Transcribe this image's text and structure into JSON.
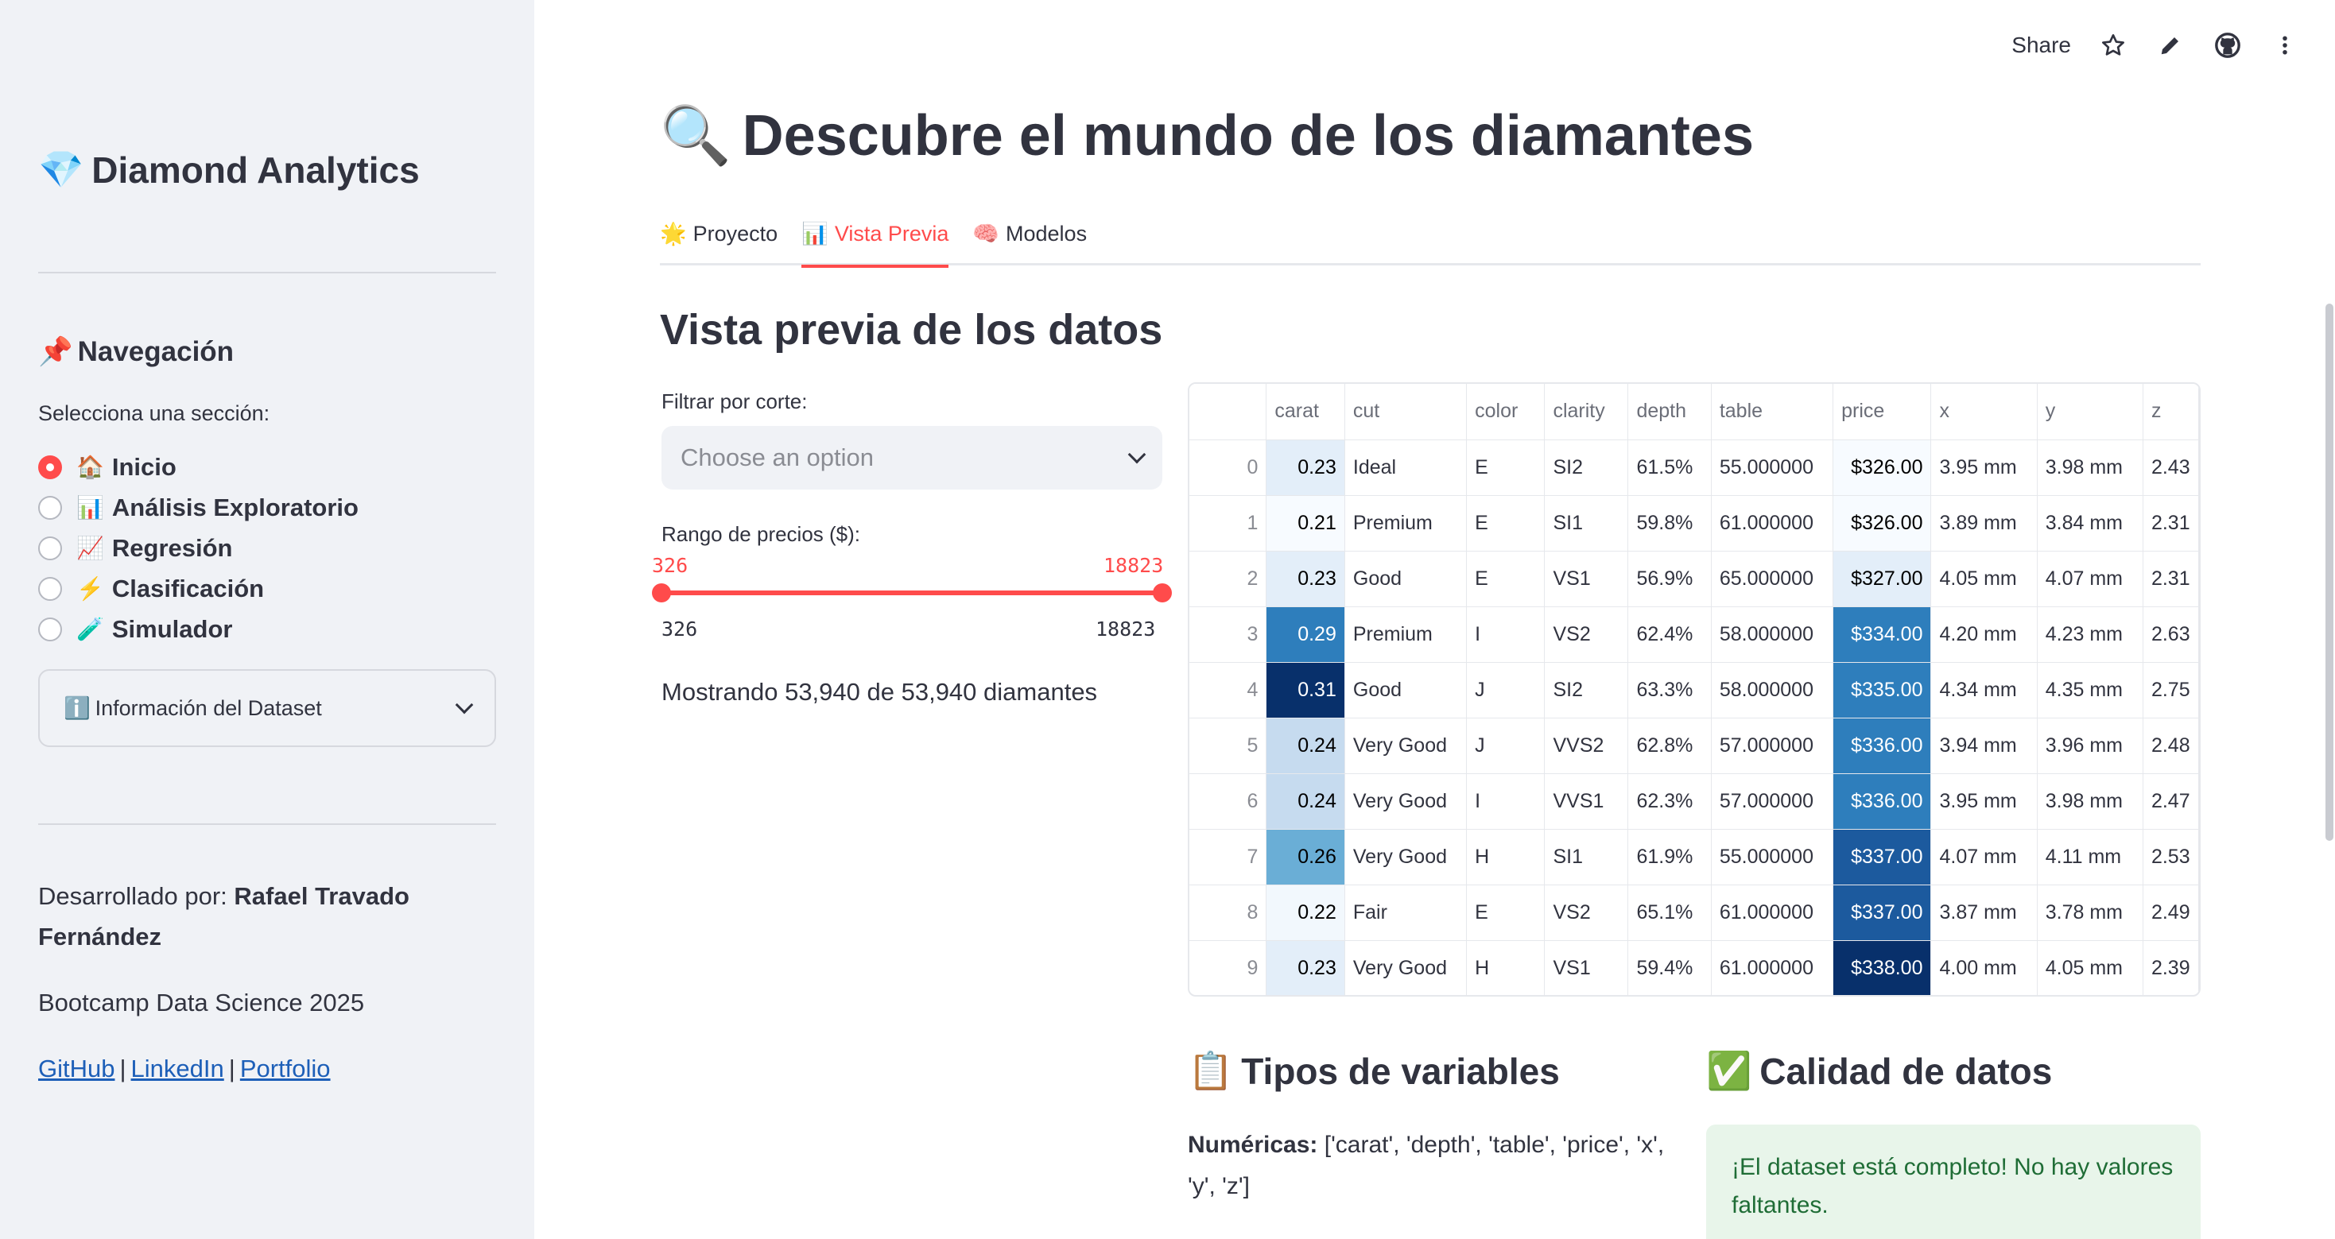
{
  "sidebar": {
    "app_title": "Diamond Analytics",
    "app_icon": "gem-icon",
    "nav_title": "Navegación",
    "section_label": "Selecciona una sección:",
    "items": [
      {
        "emoji": "🏠",
        "label": "Inicio",
        "selected": true
      },
      {
        "emoji": "📊",
        "label": "Análisis Exploratorio",
        "selected": false
      },
      {
        "emoji": "📈",
        "label": "Regresión",
        "selected": false
      },
      {
        "emoji": "⚡",
        "label": "Clasificación",
        "selected": false
      },
      {
        "emoji": "🧪",
        "label": "Simulador",
        "selected": false
      }
    ],
    "expander_label": "Información del Dataset",
    "developed_by_prefix": "Desarrollado por: ",
    "developer": "Rafael Travado Fernández",
    "bootcamp": "Bootcamp Data Science 2025",
    "links": [
      "GitHub",
      "LinkedIn",
      "Portfolio"
    ]
  },
  "toolbar": {
    "share": "Share"
  },
  "main": {
    "title": "Descubre el mundo de los diamantes",
    "tabs": [
      {
        "emoji": "🌟",
        "label": "Proyecto",
        "active": false
      },
      {
        "emoji": "📊",
        "label": "Vista Previa",
        "active": true
      },
      {
        "emoji": "🧠",
        "label": "Modelos",
        "active": false
      }
    ],
    "section_title": "Vista previa de los datos",
    "filter_label": "Filtrar por corte:",
    "filter_placeholder": "Choose an option",
    "range_label": "Rango de precios ($):",
    "range_min": "326",
    "range_max": "18823",
    "range_selected_low": "326",
    "range_selected_high": "18823",
    "showing_text": "Mostrando 53,940 de 53,940 diamantes"
  },
  "table": {
    "columns": [
      "",
      "carat",
      "cut",
      "color",
      "clarity",
      "depth",
      "table",
      "price",
      "x",
      "y",
      "z"
    ],
    "rows": [
      [
        "0",
        "0.23",
        "Ideal",
        "E",
        "SI2",
        "61.5%",
        "55.000000",
        "$326.00",
        "3.95 mm",
        "3.98 mm",
        "2.43"
      ],
      [
        "1",
        "0.21",
        "Premium",
        "E",
        "SI1",
        "59.8%",
        "61.000000",
        "$326.00",
        "3.89 mm",
        "3.84 mm",
        "2.31"
      ],
      [
        "2",
        "0.23",
        "Good",
        "E",
        "VS1",
        "56.9%",
        "65.000000",
        "$327.00",
        "4.05 mm",
        "4.07 mm",
        "2.31"
      ],
      [
        "3",
        "0.29",
        "Premium",
        "I",
        "VS2",
        "62.4%",
        "58.000000",
        "$334.00",
        "4.20 mm",
        "4.23 mm",
        "2.63"
      ],
      [
        "4",
        "0.31",
        "Good",
        "J",
        "SI2",
        "63.3%",
        "58.000000",
        "$335.00",
        "4.34 mm",
        "4.35 mm",
        "2.75"
      ],
      [
        "5",
        "0.24",
        "Very Good",
        "J",
        "VVS2",
        "62.8%",
        "57.000000",
        "$336.00",
        "3.94 mm",
        "3.96 mm",
        "2.48"
      ],
      [
        "6",
        "0.24",
        "Very Good",
        "I",
        "VVS1",
        "62.3%",
        "57.000000",
        "$336.00",
        "3.95 mm",
        "3.98 mm",
        "2.47"
      ],
      [
        "7",
        "0.26",
        "Very Good",
        "H",
        "SI1",
        "61.9%",
        "55.000000",
        "$337.00",
        "4.07 mm",
        "4.11 mm",
        "2.53"
      ],
      [
        "8",
        "0.22",
        "Fair",
        "E",
        "VS2",
        "65.1%",
        "61.000000",
        "$337.00",
        "3.87 mm",
        "3.78 mm",
        "2.49"
      ],
      [
        "9",
        "0.23",
        "Very Good",
        "H",
        "VS1",
        "59.4%",
        "61.000000",
        "$338.00",
        "4.00 mm",
        "4.05 mm",
        "2.39"
      ]
    ],
    "carat_colors": [
      "#e3eef9",
      "#f7fbff",
      "#e3eef9",
      "#2e7ebc",
      "#08306b",
      "#c6dbef",
      "#c6dbef",
      "#6aaed6",
      "#f2f8fd",
      "#e3eef9"
    ],
    "price_colors": [
      "#f7fbff",
      "#f7fbff",
      "#e3eef9",
      "#2e7ebc",
      "#2e7ebc",
      "#2e7ebc",
      "#2e7ebc",
      "#1c5a9e",
      "#1c5a9e",
      "#08306b"
    ]
  },
  "types": {
    "title": "Tipos de variables",
    "numeric_label": "Numéricas:",
    "numeric_values": " ['carat', 'depth', 'table', 'price', 'x', 'y', 'z']"
  },
  "quality": {
    "title": "Calidad de datos",
    "message": "¡El dataset está completo! No hay valores faltantes."
  }
}
